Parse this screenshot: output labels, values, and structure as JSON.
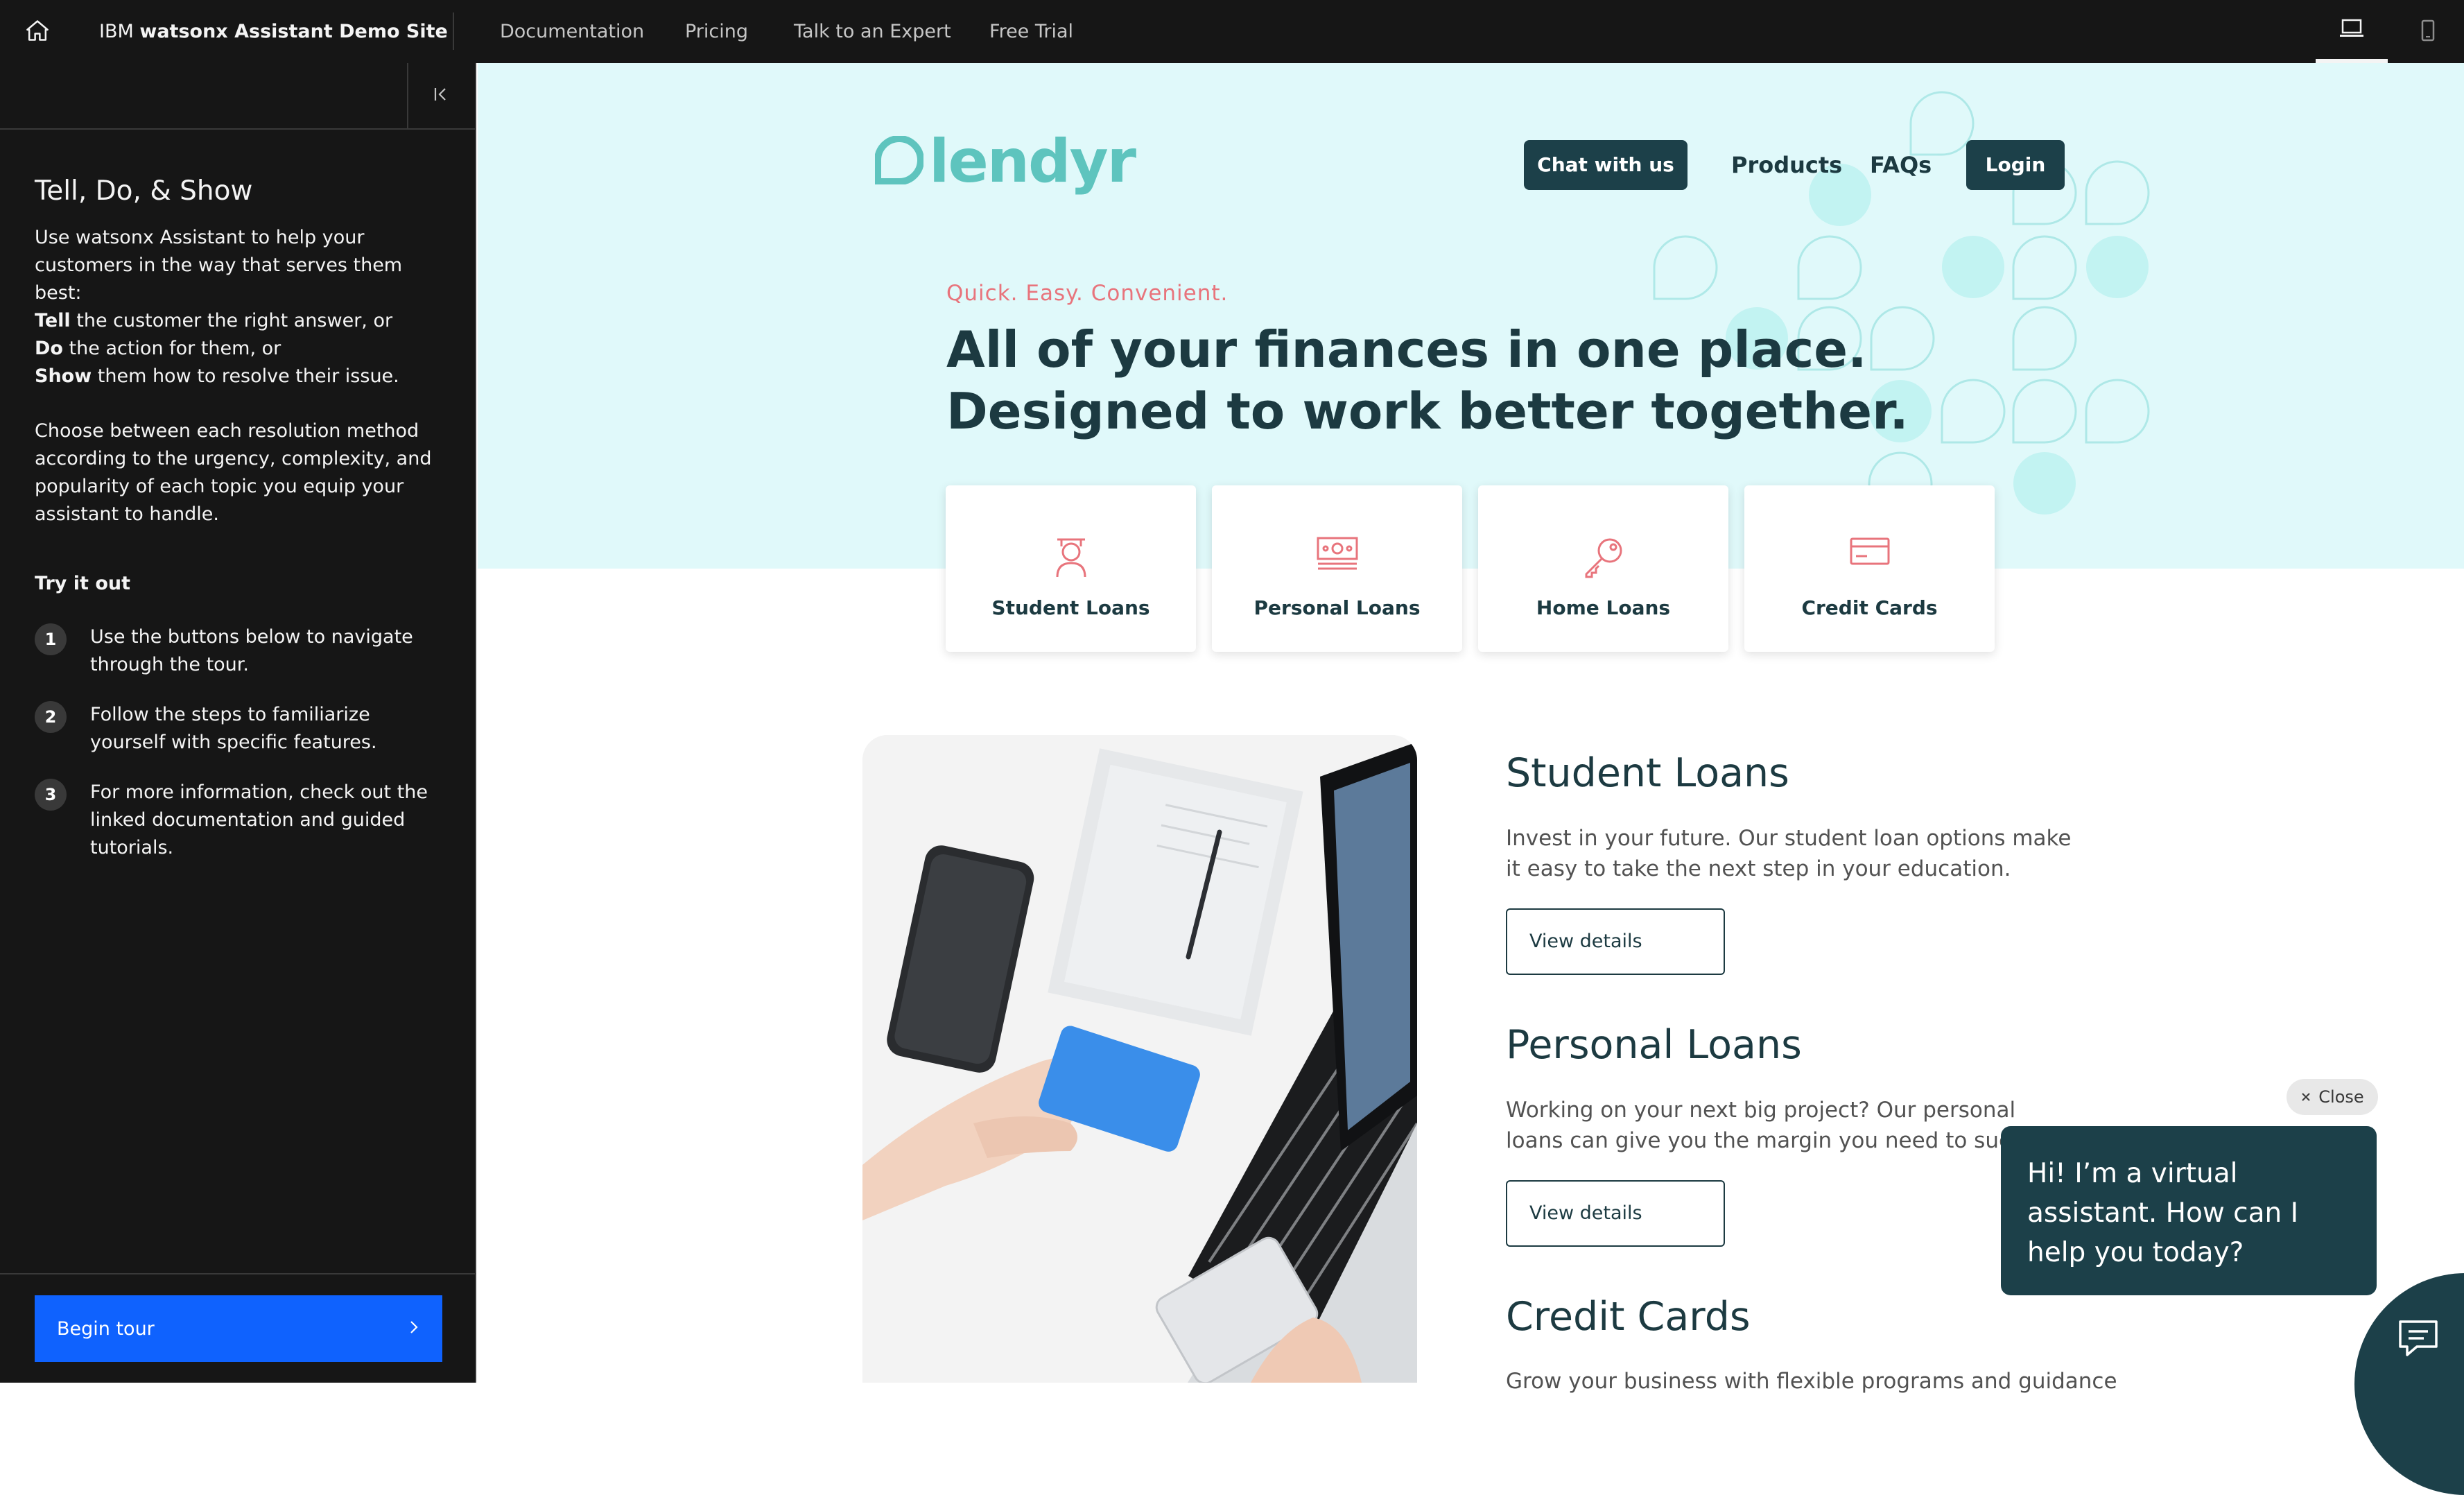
{
  "topbar": {
    "brand_prefix": "IBM ",
    "brand_name": "watsonx Assistant Demo Site",
    "nav": [
      "Documentation",
      "Pricing",
      "Talk to an Expert",
      "Free Trial"
    ]
  },
  "sidebar": {
    "title": "Tell, Do, & Show",
    "intro": "Use watsonx Assistant to help your customers in the way that serves them best:",
    "tell_word": "Tell",
    "tell_rest": " the customer the right answer, or",
    "do_word": "Do",
    "do_rest": " the action for them, or",
    "show_word": "Show",
    "show_rest": " them how to resolve their issue.",
    "choose": "Choose between each resolution method according to the urgency, complexity, and popularity of each topic you equip your assistant to handle.",
    "try_title": "Try it out",
    "steps": [
      {
        "num": "1",
        "text": "Use the buttons below to navigate through the tour."
      },
      {
        "num": "2",
        "text": "Follow the steps to familiarize yourself with specific features."
      },
      {
        "num": "3",
        "text": "For more information, check out the linked documentation and guided tutorials."
      }
    ],
    "begin_tour": "Begin tour"
  },
  "site": {
    "logo_text": "lendyr",
    "nav": {
      "chat": "Chat with us",
      "products": "Products",
      "faqs": "FAQs",
      "login": "Login"
    },
    "tagline": "Quick. Easy. Convenient.",
    "headline_1": "All of your finances in one place.",
    "headline_2": "Designed to work better together.",
    "categories": [
      "Student Loans",
      "Personal Loans",
      "Home Loans",
      "Credit Cards"
    ],
    "products": [
      {
        "title": "Student Loans",
        "desc": "Invest in your future. Our student loan options make it easy to take the next step in your education.",
        "button": "View details"
      },
      {
        "title": "Personal Loans",
        "desc": "Working on your next big project? Our personal loans can give you the margin you need to succeed.",
        "button": "View details"
      },
      {
        "title": "Credit Cards",
        "desc": "Grow your business with flexible programs and guidance"
      }
    ]
  },
  "chat": {
    "close_label": "Close",
    "greeting": "Hi! I’m a virtual assistant. How can I help you today?"
  },
  "colors": {
    "topbar_bg": "#161616",
    "hero_bg": "#e0f9fa",
    "brand_teal": "#5ec4be",
    "dark_teal": "#1c4049",
    "tagline_coral": "#e8747c",
    "category_icon_coral": "#e8747c",
    "tour_blue": "#0f62fe"
  },
  "icons": [
    "home-icon",
    "collapse-panel-icon",
    "chevron-right-icon",
    "laptop-icon",
    "mobile-icon",
    "graduation-icon",
    "cash-icon",
    "key-icon",
    "credit-card-icon",
    "close-icon",
    "chat-icon"
  ]
}
